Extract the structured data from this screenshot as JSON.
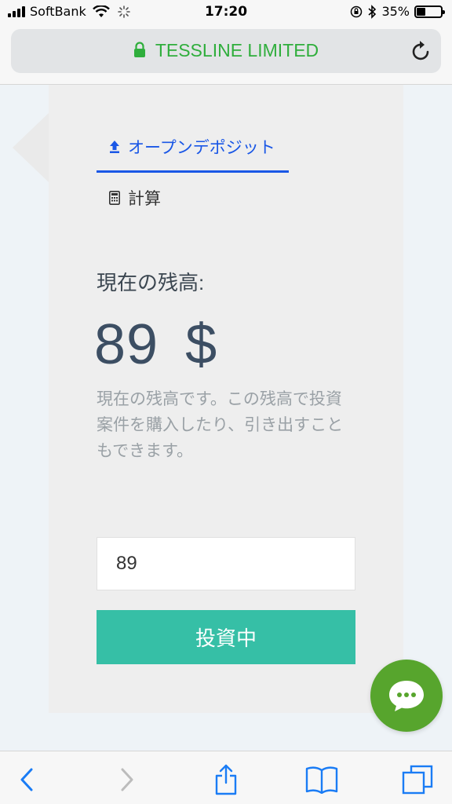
{
  "status_bar": {
    "carrier": "SoftBank",
    "time": "17:20",
    "battery_text": "35%",
    "battery_level": 0.35
  },
  "browser": {
    "site_title": "TESSLINE LIMITED",
    "icons": {
      "lock": "lock-icon",
      "reload": "reload-icon"
    }
  },
  "tabs": [
    {
      "label": "オープンデポジット",
      "icon": "upload-icon",
      "active": true
    },
    {
      "label": "計算",
      "icon": "calculator-icon",
      "active": false
    }
  ],
  "balance": {
    "label": "現在の残高:",
    "amount": "89",
    "currency": "$",
    "description": "現在の残高です。この残高で投資案件を購入したり、引き出すこともできます。"
  },
  "form": {
    "input_value": "89",
    "submit_label": "投資中"
  },
  "chat": {
    "icon": "chat-bubble-icon"
  },
  "toolbar": {
    "back": "back-chevron-icon",
    "forward": "forward-chevron-icon",
    "share": "share-icon",
    "bookmarks": "bookmarks-icon",
    "tabs": "tabs-icon"
  },
  "colors": {
    "accent_blue": "#1a57e6",
    "secure_green": "#2fae3c",
    "button_teal": "#36bfa6",
    "chat_green": "#57a52d",
    "ios_blue": "#1a7cf5"
  }
}
